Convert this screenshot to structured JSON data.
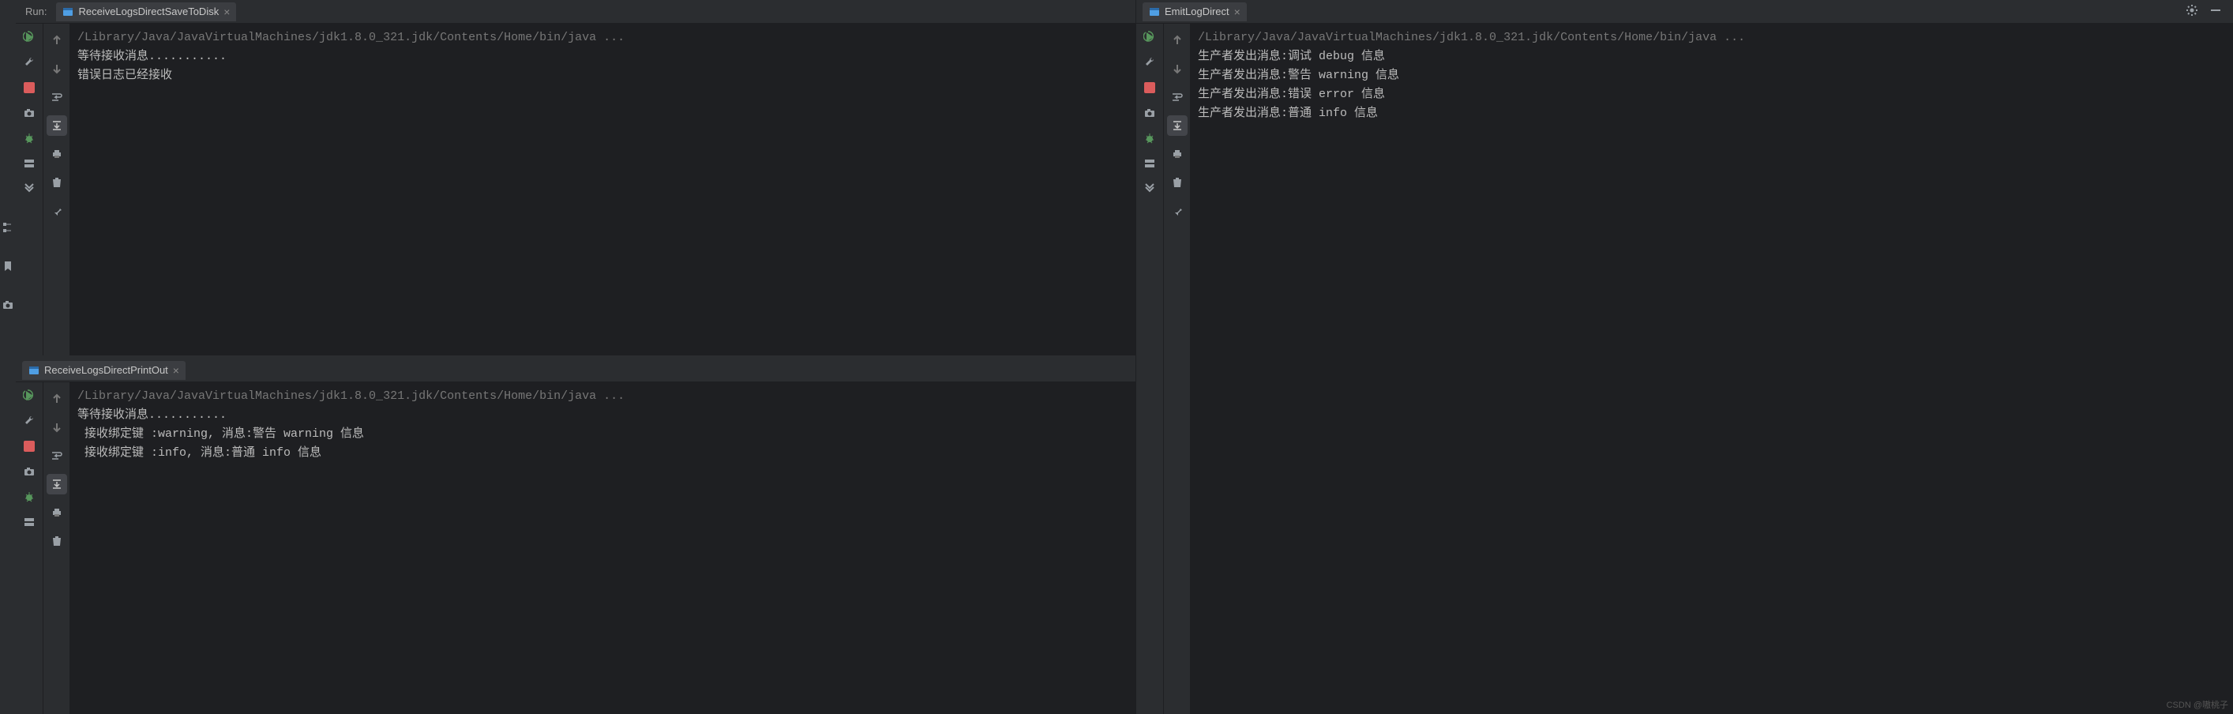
{
  "run_label": "Run:",
  "tabs": {
    "t1": "ReceiveLogsDirectSaveToDisk",
    "t2": "ReceiveLogsDirectPrintOut",
    "t3": "EmitLogDirect"
  },
  "consoles": {
    "c1": {
      "path": "/Library/Java/JavaVirtualMachines/jdk1.8.0_321.jdk/Contents/Home/bin/java ...",
      "l1": "等待接收消息...........",
      "l2": "错误日志已经接收"
    },
    "c2": {
      "path": "/Library/Java/JavaVirtualMachines/jdk1.8.0_321.jdk/Contents/Home/bin/java ...",
      "l1": "等待接收消息...........",
      "l2": " 接收绑定键 :warning, 消息:警告 warning 信息",
      "l3": " 接收绑定键 :info, 消息:普通 info 信息"
    },
    "c3": {
      "path": "/Library/Java/JavaVirtualMachines/jdk1.8.0_321.jdk/Contents/Home/bin/java ...",
      "l1": "生产者发出消息:调试 debug 信息",
      "l2": "生产者发出消息:警告 warning 信息",
      "l3": "生产者发出消息:错误 error 信息",
      "l4": "生产者发出消息:普通 info 信息"
    }
  },
  "watermark": "CSDN @嗷桃子"
}
